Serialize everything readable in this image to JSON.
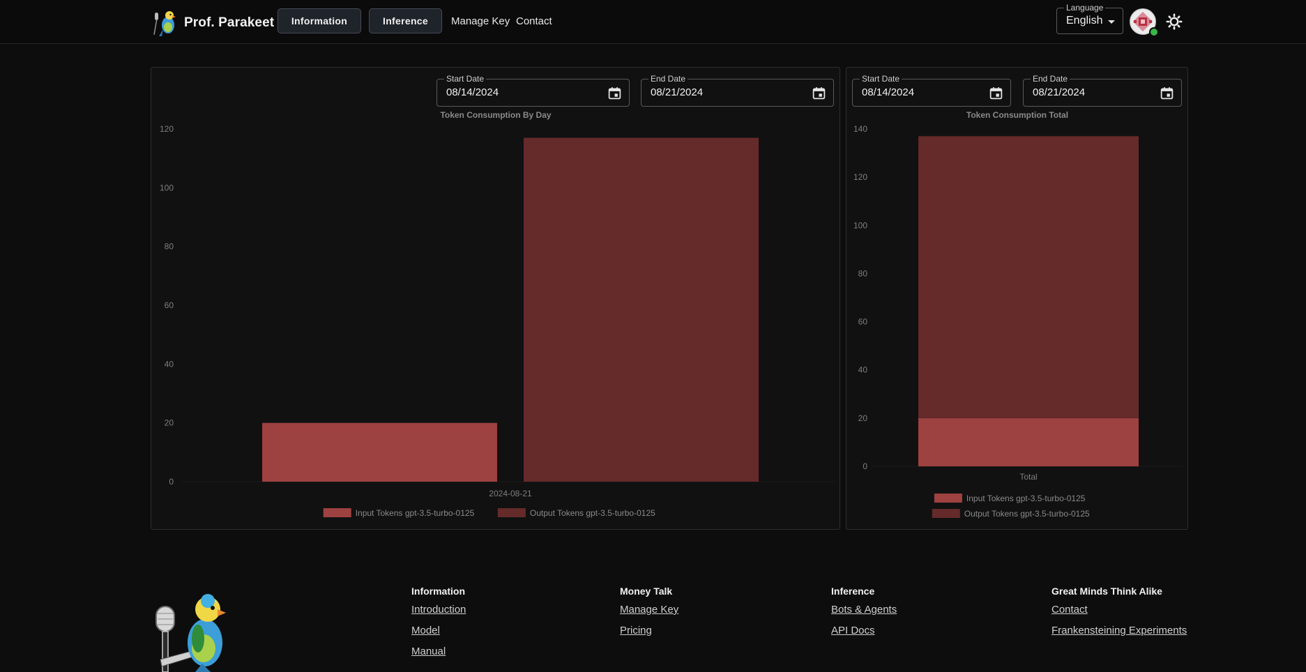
{
  "header": {
    "brand": "Prof. Parakeet",
    "nav_buttons": [
      "Information",
      "Inference"
    ],
    "nav_links": [
      "Manage Key",
      "Contact"
    ],
    "language": {
      "label": "Language",
      "value": "English"
    }
  },
  "daily_panel": {
    "start_date": {
      "label": "Start Date",
      "value": "08/14/2024"
    },
    "end_date": {
      "label": "End Date",
      "value": "08/21/2024"
    }
  },
  "total_panel": {
    "start_date": {
      "label": "Start Date",
      "value": "08/14/2024"
    },
    "end_date": {
      "label": "End Date",
      "value": "08/21/2024"
    }
  },
  "colors": {
    "input_tokens": "#9e4141",
    "output_tokens": "#652a2a"
  },
  "chart_data": [
    {
      "type": "bar",
      "title": "Token Consumption By Day",
      "categories": [
        "2024-08-21"
      ],
      "series": [
        {
          "name": "Input Tokens gpt-3.5-turbo-0125",
          "values": [
            20
          ]
        },
        {
          "name": "Output Tokens gpt-3.5-turbo-0125",
          "values": [
            117
          ]
        }
      ],
      "ylim": [
        0,
        120
      ],
      "yticks": [
        0,
        20,
        40,
        60,
        80,
        100,
        120
      ],
      "legend": "bottom"
    },
    {
      "type": "bar",
      "stacked": true,
      "title": "Token Consumption Total",
      "categories": [
        "Total"
      ],
      "series": [
        {
          "name": "Input Tokens gpt-3.5-turbo-0125",
          "values": [
            20
          ]
        },
        {
          "name": "Output Tokens gpt-3.5-turbo-0125",
          "values": [
            117
          ]
        }
      ],
      "ylim": [
        0,
        140
      ],
      "yticks": [
        0,
        20,
        40,
        60,
        80,
        100,
        120,
        140
      ],
      "legend": "bottom"
    }
  ],
  "footer": {
    "columns": [
      {
        "heading": "Information",
        "links": [
          "Introduction",
          "Model",
          "Manual"
        ]
      },
      {
        "heading": "Money Talk",
        "links": [
          "Manage Key",
          "Pricing"
        ]
      },
      {
        "heading": "Inference",
        "links": [
          "Bots & Agents",
          "API Docs"
        ]
      },
      {
        "heading": "Great Minds Think Alike",
        "links": [
          "Contact",
          "Frankensteining Experiments"
        ]
      }
    ]
  }
}
